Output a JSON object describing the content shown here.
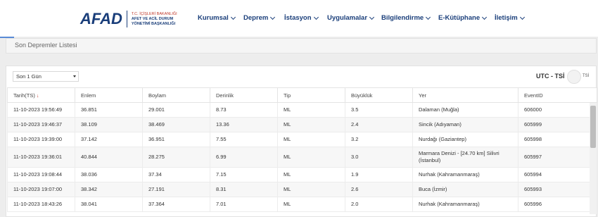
{
  "logo": {
    "word": "AFAD",
    "sub_line1": "T.C. İÇİŞLERİ BAKANLIĞI",
    "sub_line2": "AFET VE ACİL DURUM",
    "sub_line3": "YÖNETİMİ BAŞKANLIĞI"
  },
  "nav": [
    {
      "label": "Kurumsal"
    },
    {
      "label": "Deprem"
    },
    {
      "label": "İstasyon"
    },
    {
      "label": "Uygulamalar"
    },
    {
      "label": "Bilgilendirme"
    },
    {
      "label": "E-Kütüphane"
    },
    {
      "label": "İletişim"
    }
  ],
  "section_title": "Son Depremler Listesi",
  "filter": {
    "selected": "Son 1 Gün"
  },
  "utc": {
    "label": "UTC - TSİ",
    "toggle_label": "TSİ"
  },
  "table": {
    "headers": [
      "Tarih(TS)",
      "Enlem",
      "Boylam",
      "Derinlik",
      "Tip",
      "Büyüklük",
      "Yer",
      "EventID"
    ],
    "rows": [
      [
        "11-10-2023 19:56:49",
        "36.851",
        "29.001",
        "8.73",
        "ML",
        "3.5",
        "Dalaman (Muğla)",
        "606000"
      ],
      [
        "11-10-2023 19:46:37",
        "38.109",
        "38.469",
        "13.36",
        "ML",
        "2.4",
        "Sincik (Adıyaman)",
        "605999"
      ],
      [
        "11-10-2023 19:39:00",
        "37.142",
        "36.951",
        "7.55",
        "ML",
        "3.2",
        "Nurdağı (Gaziantep)",
        "605998"
      ],
      [
        "11-10-2023 19:36:01",
        "40.844",
        "28.275",
        "6.99",
        "ML",
        "3.0",
        "Marmara Denizi - [24.70 km] Silivri (İstanbul)",
        "605997"
      ],
      [
        "11-10-2023 19:08:44",
        "38.036",
        "37.34",
        "7.15",
        "ML",
        "1.9",
        "Nurhak (Kahramanmaraş)",
        "605994"
      ],
      [
        "11-10-2023 19:07:00",
        "38.342",
        "27.191",
        "8.31",
        "ML",
        "2.6",
        "Buca (İzmir)",
        "605993"
      ],
      [
        "11-10-2023 18:43:26",
        "38.041",
        "37.364",
        "7.01",
        "ML",
        "2.0",
        "Nurhak (Kahramanmaraş)",
        "605996"
      ]
    ]
  },
  "colors": {
    "brand": "#1a3e7a",
    "accent_red": "#c0392b",
    "strip": "#5a8bd6"
  }
}
